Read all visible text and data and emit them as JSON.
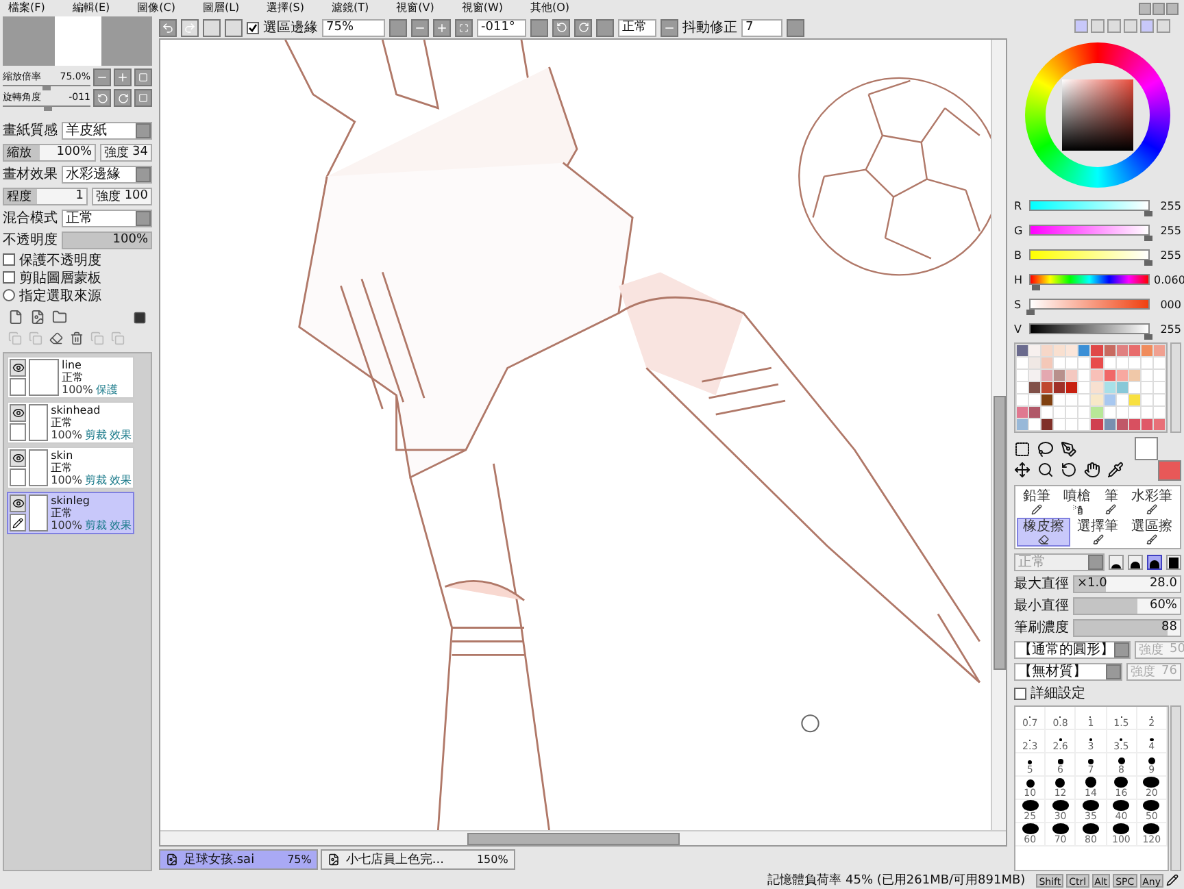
{
  "menu": [
    "檔案(F)",
    "編輯(E)",
    "圖像(C)",
    "圖層(L)",
    "選擇(S)",
    "濾鏡(T)",
    "視窗(V)",
    "視窗(W)",
    "其他(O)"
  ],
  "toolbar": {
    "selection_edge": {
      "label": "選區邊緣",
      "checked": true
    },
    "zoom": "75%",
    "angle": "-011°",
    "blend": "正常",
    "stabilizer": {
      "label": "抖動修正",
      "value": "7"
    }
  },
  "navigator": {
    "zoom": {
      "label": "縮放倍率",
      "value": "75.0%",
      "level": 0.45
    },
    "angle": {
      "label": "旋轉角度",
      "value": "-011",
      "level": 0.47
    }
  },
  "paper": {
    "texture": {
      "label": "畫紙質感",
      "value": "羊皮紙"
    },
    "scale": {
      "label": "縮放",
      "value": "100%"
    },
    "texture_strength": {
      "label": "強度",
      "value": "34"
    },
    "effect": {
      "label": "畫材效果",
      "value": "水彩邊緣"
    },
    "width": {
      "label": "程度",
      "value": "1"
    },
    "effect_strength": {
      "label": "強度",
      "value": "100"
    }
  },
  "blend": {
    "label": "混合模式",
    "value": "正常"
  },
  "opacity": {
    "label": "不透明度",
    "value": "100%",
    "level": 1
  },
  "options": [
    {
      "label": "保護不透明度",
      "kind": "checkbox",
      "checked": false
    },
    {
      "label": "剪貼圖層蒙板",
      "kind": "checkbox",
      "checked": false
    },
    {
      "label": "指定選取來源",
      "kind": "radio",
      "checked": false
    }
  ],
  "layers": [
    {
      "name": "line",
      "mode": "正常",
      "opacity": "100%",
      "flags": [
        "保護"
      ],
      "visible": true,
      "selected": false
    },
    {
      "name": "skinhead",
      "mode": "正常",
      "opacity": "100%",
      "flags": [
        "剪裁",
        "效果"
      ],
      "visible": true,
      "selected": false
    },
    {
      "name": "skin",
      "mode": "正常",
      "opacity": "100%",
      "flags": [
        "剪裁",
        "效果"
      ],
      "visible": true,
      "selected": false
    },
    {
      "name": "skinleg",
      "mode": "正常",
      "opacity": "100%",
      "flags": [
        "剪裁",
        "效果"
      ],
      "visible": true,
      "selected": true
    }
  ],
  "rgb": [
    {
      "label": "R",
      "value": "255",
      "level": 1,
      "kind": "r"
    },
    {
      "label": "G",
      "value": "255",
      "level": 1,
      "kind": "g"
    },
    {
      "label": "B",
      "value": "255",
      "level": 1,
      "kind": "b"
    },
    {
      "label": "H",
      "value": "0.060",
      "level": 0.05,
      "kind": "h"
    },
    {
      "label": "S",
      "value": "000",
      "level": 0,
      "kind": "s"
    },
    {
      "label": "V",
      "value": "255",
      "level": 1,
      "kind": "v"
    }
  ],
  "swatches": [
    {
      "color": "#6b6b8e"
    },
    {
      "color": "#f7f0ee"
    },
    {
      "color": "#f6d7c8"
    },
    {
      "color": "#f9e0d0"
    },
    {
      "color": "#fbe6da"
    },
    {
      "color": "#3b8fd6"
    },
    {
      "color": "#e04848"
    },
    {
      "color": "#c86a60"
    },
    {
      "color": "#e08080"
    },
    {
      "color": "#e86c6c"
    },
    {
      "color": "#f08c5c"
    },
    {
      "color": "#f0a090"
    },
    {
      "color": "#ffffff"
    },
    {
      "color": "#f0e8e4"
    },
    {
      "color": "#f4c8b8"
    },
    {
      "color": "#ffffff"
    },
    {
      "color": "#ffffff"
    },
    {
      "color": "#ffffff"
    },
    {
      "color": "#e84c4c"
    },
    {
      "color": "#ffffff"
    },
    {
      "color": "#ffffff"
    },
    {
      "color": "#ffffff"
    },
    {
      "color": "#ffffff"
    },
    {
      "color": "#ffffff"
    },
    {
      "color": "#ffffff"
    },
    {
      "color": "#f4f0f0"
    },
    {
      "color": "#e4a8b0"
    },
    {
      "color": "#b8908c"
    },
    {
      "color": "#f4c8c0"
    },
    {
      "color": "#ffffff"
    },
    {
      "color": "#f8c0b8"
    },
    {
      "color": "#f06868"
    },
    {
      "color": "#f8a8a0"
    },
    {
      "color": "#f0c8a8"
    },
    {
      "color": "#ffffff"
    },
    {
      "color": "#ffffff"
    },
    {
      "color": "#ffffff"
    },
    {
      "color": "#805048"
    },
    {
      "color": "#c04830"
    },
    {
      "color": "#a03028"
    },
    {
      "color": "#c82010"
    },
    {
      "color": "#ffffff"
    },
    {
      "color": "#f8e0d0"
    },
    {
      "color": "#a8e0e8"
    },
    {
      "color": "#88c8d8"
    },
    {
      "color": "#ffffff"
    },
    {
      "color": "#ffffff"
    },
    {
      "color": "#ffffff"
    },
    {
      "color": "#ffffff"
    },
    {
      "color": "#ffffff"
    },
    {
      "color": "#804010"
    },
    {
      "color": "#ffffff"
    },
    {
      "color": "#ffffff"
    },
    {
      "color": "#ffffff"
    },
    {
      "color": "#f8e8c8"
    },
    {
      "color": "#a8c8f0"
    },
    {
      "color": "#ffffff"
    },
    {
      "color": "#f8e040"
    },
    {
      "color": "#ffffff"
    },
    {
      "color": "#ffffff"
    },
    {
      "color": "#e07890"
    },
    {
      "color": "#b05868"
    },
    {
      "color": "#ffffff"
    },
    {
      "color": "#ffffff"
    },
    {
      "color": "#ffffff"
    },
    {
      "color": "#ffffff"
    },
    {
      "color": "#b8e898"
    },
    {
      "color": "#ffffff"
    },
    {
      "color": "#ffffff"
    },
    {
      "color": "#ffffff"
    },
    {
      "color": "#ffffff"
    },
    {
      "color": "#ffffff"
    },
    {
      "color": "#98b8d8"
    },
    {
      "color": "#ffffff"
    },
    {
      "color": "#803028"
    },
    {
      "color": "#ffffff"
    },
    {
      "color": "#ffffff"
    },
    {
      "color": "#ffffff"
    },
    {
      "color": "#d04050"
    },
    {
      "color": "#7890b0"
    },
    {
      "color": "#c05868"
    },
    {
      "color": "#d85060"
    },
    {
      "color": "#e05868"
    },
    {
      "color": "#e87078"
    }
  ],
  "brushes": [
    {
      "label": "鉛筆",
      "selected": false
    },
    {
      "label": "噴槍",
      "selected": false
    },
    {
      "label": "筆",
      "selected": false
    },
    {
      "label": "水彩筆",
      "selected": false
    },
    {
      "label": "橡皮擦",
      "selected": true
    },
    {
      "label": "選擇筆",
      "selected": false
    },
    {
      "label": "選區擦",
      "selected": false
    }
  ],
  "brush_mode": {
    "value": "正常",
    "shapes": [
      {
        "selected": false
      },
      {
        "selected": false
      },
      {
        "selected": true
      },
      {
        "selected": false
      }
    ]
  },
  "max_size": {
    "label": "最大直徑",
    "multiplier": "×1.0",
    "value": "28.0",
    "level": 0.3
  },
  "min_size": {
    "label": "最小直徑",
    "value": "60%",
    "level": 0.6
  },
  "density": {
    "label": "筆刷濃度",
    "value": "88",
    "level": 0.88
  },
  "shape": {
    "value": "【通常的圓形】",
    "strength_label": "強度",
    "strength": "50"
  },
  "texture": {
    "value": "【無材質】",
    "strength_label": "強度",
    "strength": "76"
  },
  "advanced": {
    "label": "詳細設定",
    "checked": false
  },
  "sizes": [
    "0.7",
    "0.8",
    "1",
    "1.5",
    "2",
    "2.3",
    "2.6",
    "3",
    "3.5",
    "4",
    "5",
    "6",
    "7",
    "8",
    "9",
    "10",
    "12",
    "14",
    "16",
    "20",
    "25",
    "30",
    "35",
    "40",
    "50",
    "60",
    "70",
    "80",
    "100",
    "120"
  ],
  "documents": [
    {
      "name": "足球女孩.sai",
      "zoom": "75%",
      "selected": true
    },
    {
      "name": "小七店員上色完...",
      "zoom": "150%",
      "selected": false
    }
  ],
  "status": {
    "memory": "記憶體負荷率 45% (已用261MB/可用891MB)",
    "keys": [
      "Shift",
      "Ctrl",
      "Alt",
      "SPC",
      "Any"
    ]
  }
}
